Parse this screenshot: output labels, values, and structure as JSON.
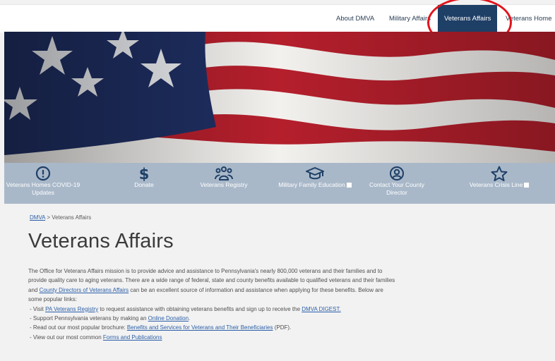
{
  "nav": {
    "items": [
      {
        "label": "About DMVA"
      },
      {
        "label": "Military Affairs"
      },
      {
        "label": "Veterans Affairs",
        "active": true
      },
      {
        "label": "Veterans Home"
      }
    ]
  },
  "quick_links": [
    {
      "label_line1": "Veterans Homes COVID-19",
      "label_line2": "Updates",
      "icon": "alert-circle-icon"
    },
    {
      "label_line1": "Donate",
      "label_line2": "",
      "icon": "dollar-icon"
    },
    {
      "label_line1": "Veterans Registry",
      "label_line2": "",
      "icon": "people-icon"
    },
    {
      "label_line1": "Military Family Education",
      "label_line2": "",
      "icon": "graduation-cap-icon",
      "external": true
    },
    {
      "label_line1": "Contact Your County",
      "label_line2": "Director",
      "icon": "user-circle-icon"
    },
    {
      "label_line1": "Veterans Crisis Line",
      "label_line2": "",
      "icon": "star-icon",
      "external": true
    }
  ],
  "breadcrumb": {
    "home": "DMVA",
    "separator": ">",
    "current": "Veterans Affairs"
  },
  "page_title": "Veterans Affairs",
  "intro": {
    "text_before": "The Office for Veterans Affairs mission is to provide advice and assistance to Pennsylvania's nearly 800,000 veterans and their families and to provide quality care to aging veterans. There are a wide range of federal, state and county benefits available to qualified veterans and their families and ",
    "link": "County Directors of Veterans Affairs",
    "text_after": " can be an excellent source of information and assistance when applying for these benefits. Below are some popular links:"
  },
  "links": [
    {
      "before": "Visit ",
      "link": "PA Veterans Registry",
      "after": " to request assistance with obtaining veterans benefits and sign up to receive the ",
      "link2": "DMVA DIGEST."
    },
    {
      "before": "Support Pennsylvania veterans by making an ",
      "link": "Online Donation",
      "after": "."
    },
    {
      "before": "Read out our most popular brochure: ",
      "link": "Benefits and Services for Veterans and Their Beneficiaries",
      "after": " (PDF)."
    },
    {
      "before": "View out our most common ",
      "link": "Forms and Publications",
      "after": ""
    }
  ],
  "colors": {
    "nav_active": "#1e3f66",
    "quick_bar": "#a9b8c9",
    "link": "#2b5fa8",
    "annotation_circle": "#e0141c"
  }
}
